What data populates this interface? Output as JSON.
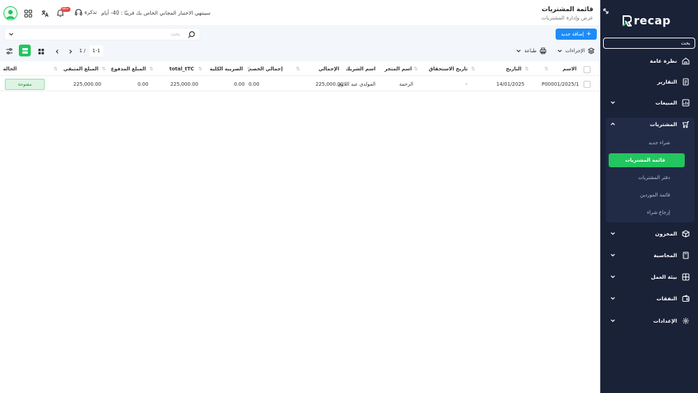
{
  "header": {
    "title": "قائمة المشتريات",
    "subtitle": "عرض وإدارة المشتريات",
    "trial_text": "سينتهي الاختبار المجاني الخاص بك قريبًا : 40- أيام",
    "ticket_label": "تذكرة",
    "notification_count": "99+"
  },
  "toolbar": {
    "search_placeholder": "بحث",
    "add_button": "إضافة جديد",
    "actions_label": "الإجراءات",
    "print_label": "طباعة",
    "pagination_page": "1 /",
    "pagination_range": "1-1"
  },
  "table": {
    "columns": [
      "الاسم",
      "التاريخ",
      "تاريخ الاستحقاق",
      "اسم المتجر",
      "اسم الشريك",
      "الإجمالي",
      "إجمالي الخصم",
      "الضريبة الكلية",
      "total_tTC",
      "المبلغ المدفوع",
      "المبلغ المتبقي",
      "الحالة"
    ],
    "rows": [
      {
        "name": "P00001/2025/1",
        "date": "14/01/2025",
        "due_date": "-",
        "store": "الرحمة",
        "partner": "المولدي عبد اللاوي",
        "total": "225,000.00",
        "discount": "0.00",
        "tax": "0.00",
        "total_ttc": "225,000.00",
        "paid": "0.00",
        "remaining": "225,000.00",
        "status": "مفتوحة"
      }
    ]
  },
  "sidebar": {
    "logo_text": "recap",
    "search_placeholder": "بحث",
    "items": [
      {
        "label": "نظرة عامة",
        "icon": "home-icon"
      },
      {
        "label": "التقارير",
        "icon": "report-icon"
      },
      {
        "label": "المبيعات",
        "icon": "sales-icon"
      },
      {
        "label": "المشتريات",
        "icon": "cart-icon"
      },
      {
        "label": "المخزون",
        "icon": "box-icon"
      },
      {
        "label": "المحاسبة",
        "icon": "calculator-icon"
      },
      {
        "label": "بيئة العمل",
        "icon": "workspace-icon"
      },
      {
        "label": "النفقات",
        "icon": "wallet-icon"
      },
      {
        "label": "الإعدادات",
        "icon": "gear-icon"
      }
    ],
    "purchases_sub": [
      {
        "label": "شراء جديد"
      },
      {
        "label": "قائمة المشتريات"
      },
      {
        "label": "دفتر المشتريات"
      },
      {
        "label": "قائمة الموردين"
      },
      {
        "label": "إرجاع شراء"
      }
    ]
  },
  "colors": {
    "accent": "#22c55e",
    "primary_button": "#1d8cf8",
    "sidebar_bg": "#1a2238"
  }
}
